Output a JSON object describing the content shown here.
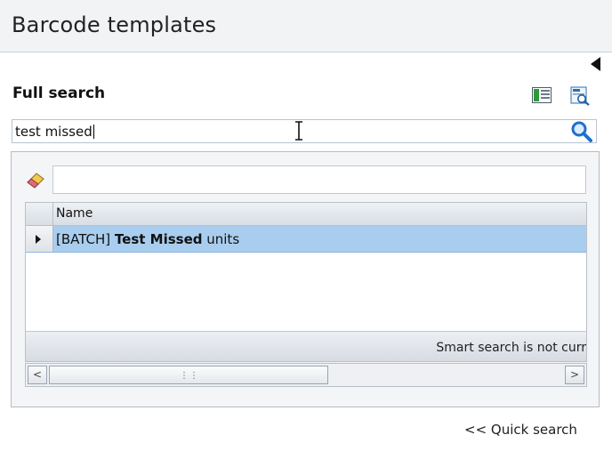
{
  "window": {
    "title": "Barcode templates"
  },
  "search": {
    "section_title": "Full search",
    "value": "test missed"
  },
  "results": {
    "filter_value": "",
    "columns": [
      "Name"
    ],
    "rows": [
      {
        "prefix": "[BATCH] ",
        "bold": "Test Missed",
        "suffix": " units"
      }
    ],
    "status_text": "Smart search is not curr"
  },
  "scrollbar": {
    "left_label": "<",
    "right_label": ">"
  },
  "footer": {
    "quick_search_label": "<< Quick search"
  },
  "colors": {
    "row_selected": "#a9cdee",
    "search_icon": "#1f6fcf"
  },
  "icons": {
    "collapse": "collapse-left-icon",
    "columns": "column-chooser-icon",
    "preview": "print-preview-icon",
    "search": "search-icon",
    "eraser": "eraser-icon",
    "cursor": "text-cursor-icon"
  }
}
